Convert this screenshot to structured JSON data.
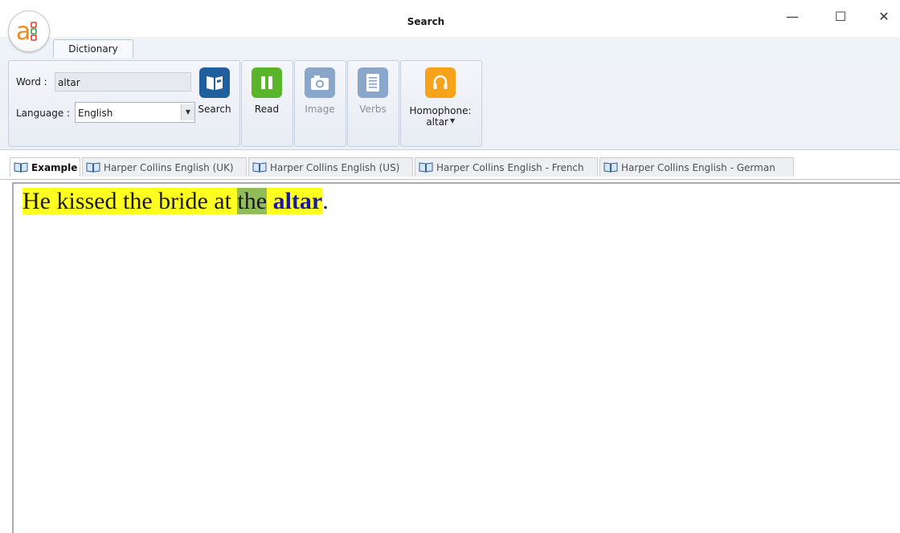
{
  "window": {
    "title": "Search",
    "minimize_glyph": "—",
    "maximize_glyph": "☐",
    "close_glyph": "✕"
  },
  "ribbon": {
    "tab_label": "Dictionary",
    "word_label": "Word :",
    "word_value": "altar",
    "language_label": "Language :",
    "language_value": "English",
    "buttons": {
      "search": "Search",
      "read": "Read",
      "image": "Image",
      "verbs": "Verbs",
      "homophone_line1": "Homophone:",
      "homophone_line2": "altar"
    }
  },
  "doc_tabs": [
    {
      "label": "Example",
      "active": true
    },
    {
      "label": "Harper Collins English (UK)",
      "active": false
    },
    {
      "label": "Harper Collins English (US)",
      "active": false
    },
    {
      "label": "Harper Collins English - French",
      "active": false
    },
    {
      "label": "Harper Collins English - German",
      "active": false
    }
  ],
  "content": {
    "part1": "He kissed the bride at ",
    "part2": "the",
    "part3": " ",
    "keyword": "altar",
    "end": "."
  },
  "colors": {
    "search_tile": "#1f5f9e",
    "read_tile": "#5ab52a",
    "image_tile": "#8aa6cb",
    "verbs_tile": "#8aa6cb",
    "homophone_tile": "#f6a21b",
    "highlight_yellow": "#ffff22",
    "highlight_green": "#91bc5b",
    "keyword_color": "#1b1a9e"
  },
  "icons": {
    "logo": "app-logo-icon",
    "search": "book-search-icon",
    "read": "pause-icon",
    "image": "camera-icon",
    "verbs": "document-list-icon",
    "homophone": "headphones-icon",
    "tab": "book-icon"
  }
}
